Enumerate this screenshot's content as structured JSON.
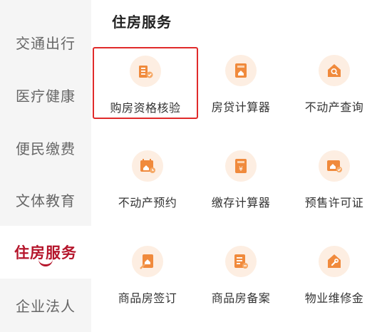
{
  "sidebar": {
    "items": [
      {
        "label": "交通出行",
        "active": false
      },
      {
        "label": "医疗健康",
        "active": false
      },
      {
        "label": "便民缴费",
        "active": false
      },
      {
        "label": "文体教育",
        "active": false
      },
      {
        "label": "住房服务",
        "active": true
      },
      {
        "label": "企业法人",
        "active": false
      }
    ]
  },
  "main": {
    "section_title": "住房服务",
    "tiles": [
      {
        "label": "购房资格核验",
        "icon": "building-check-icon",
        "selected": true
      },
      {
        "label": "房贷计算器",
        "icon": "house-calculator-icon",
        "selected": false
      },
      {
        "label": "不动产查询",
        "icon": "house-search-icon",
        "selected": false
      },
      {
        "label": "不动产预约",
        "icon": "calendar-house-icon",
        "selected": false
      },
      {
        "label": "缴存计算器",
        "icon": "yuan-calculator-icon",
        "selected": false
      },
      {
        "label": "预售许可证",
        "icon": "house-certificate-icon",
        "selected": false
      },
      {
        "label": "商品房签订",
        "icon": "contract-sign-icon",
        "selected": false
      },
      {
        "label": "商品房备案",
        "icon": "document-record-icon",
        "selected": false
      },
      {
        "label": "物业维修金",
        "icon": "wrench-icon",
        "selected": false
      }
    ]
  },
  "colors": {
    "accent": "#b5152b",
    "icon_orange": "#f08a3c",
    "icon_bg": "#fdeee2",
    "selection_border": "#e02a2a"
  }
}
